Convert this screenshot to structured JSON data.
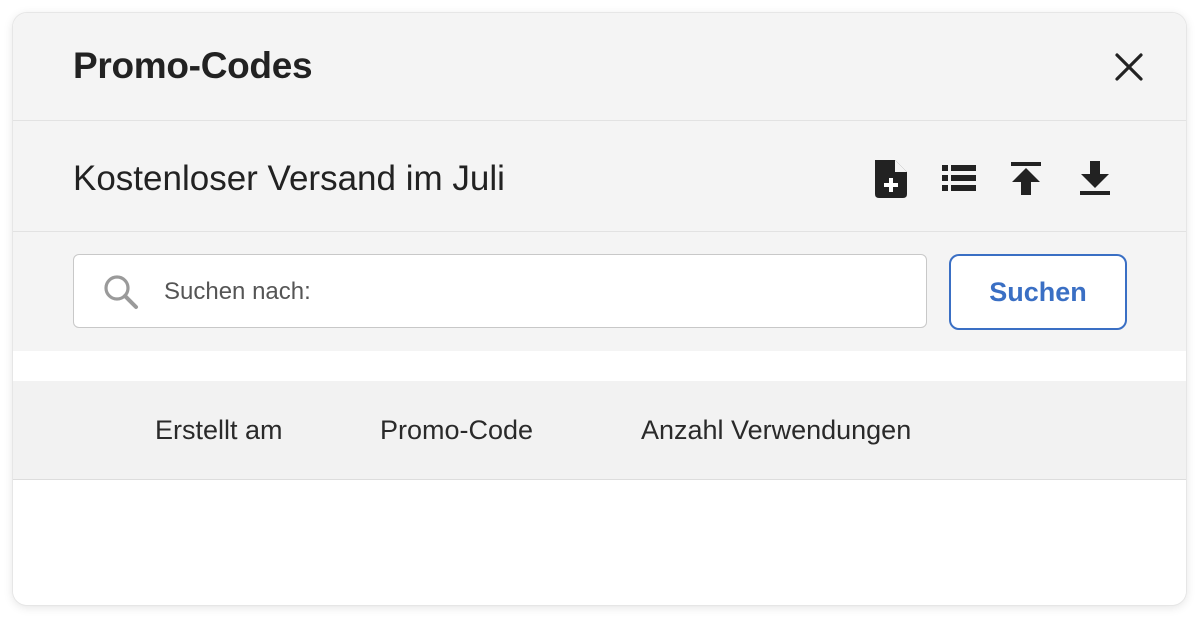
{
  "dialog": {
    "title": "Promo-Codes",
    "close_icon": "close-icon"
  },
  "campaign": {
    "name": "Kostenloser Versand im Juli",
    "toolbar": [
      {
        "icon": "add-file-icon"
      },
      {
        "icon": "list-icon"
      },
      {
        "icon": "upload-icon"
      },
      {
        "icon": "download-icon"
      }
    ]
  },
  "search": {
    "placeholder": "Suchen nach:",
    "value": "",
    "button_label": "Suchen",
    "icon": "search-icon"
  },
  "table": {
    "columns": [
      "Erstellt am",
      "Promo-Code",
      "Anzahl Verwendungen"
    ],
    "rows": []
  },
  "colors": {
    "accent": "#3a6fc4",
    "header_bg": "#f4f4f4",
    "text": "#222222"
  }
}
